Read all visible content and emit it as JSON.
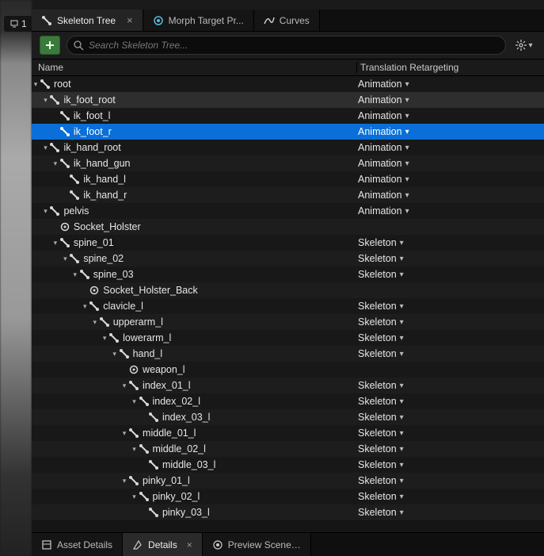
{
  "viewport_badge": "1",
  "tabs": [
    {
      "label": "Skeleton Tree",
      "active": true,
      "closable": true,
      "icon": "bone"
    },
    {
      "label": "Morph Target Pr...",
      "active": false,
      "closable": false,
      "icon": "morph"
    },
    {
      "label": "Curves",
      "active": false,
      "closable": false,
      "icon": "curve"
    }
  ],
  "search": {
    "placeholder": "Search Skeleton Tree..."
  },
  "columns": {
    "name": "Name",
    "retarget": "Translation Retargeting"
  },
  "retarget_values": {
    "animation": "Animation",
    "skeleton": "Skeleton"
  },
  "tree": [
    {
      "name": "root",
      "depth": 0,
      "type": "bone",
      "expand": "open",
      "ret": "animation",
      "state": ""
    },
    {
      "name": "ik_foot_root",
      "depth": 1,
      "type": "bone",
      "expand": "open",
      "ret": "animation",
      "state": "hovered"
    },
    {
      "name": "ik_foot_l",
      "depth": 2,
      "type": "bone",
      "expand": "",
      "ret": "animation",
      "state": ""
    },
    {
      "name": "ik_foot_r",
      "depth": 2,
      "type": "bone",
      "expand": "",
      "ret": "animation",
      "state": "selected"
    },
    {
      "name": "ik_hand_root",
      "depth": 1,
      "type": "bone",
      "expand": "open",
      "ret": "animation",
      "state": ""
    },
    {
      "name": "ik_hand_gun",
      "depth": 2,
      "type": "bone",
      "expand": "open",
      "ret": "animation",
      "state": ""
    },
    {
      "name": "ik_hand_l",
      "depth": 3,
      "type": "bone",
      "expand": "",
      "ret": "animation",
      "state": ""
    },
    {
      "name": "ik_hand_r",
      "depth": 3,
      "type": "bone",
      "expand": "",
      "ret": "animation",
      "state": ""
    },
    {
      "name": "pelvis",
      "depth": 1,
      "type": "bone",
      "expand": "open",
      "ret": "animation",
      "state": ""
    },
    {
      "name": "Socket_Holster",
      "depth": 2,
      "type": "socket",
      "expand": "",
      "ret": "",
      "state": ""
    },
    {
      "name": "spine_01",
      "depth": 2,
      "type": "bone",
      "expand": "open",
      "ret": "skeleton",
      "state": ""
    },
    {
      "name": "spine_02",
      "depth": 3,
      "type": "bone",
      "expand": "open",
      "ret": "skeleton",
      "state": ""
    },
    {
      "name": "spine_03",
      "depth": 4,
      "type": "bone",
      "expand": "open",
      "ret": "skeleton",
      "state": ""
    },
    {
      "name": "Socket_Holster_Back",
      "depth": 5,
      "type": "socket",
      "expand": "",
      "ret": "",
      "state": ""
    },
    {
      "name": "clavicle_l",
      "depth": 5,
      "type": "bone",
      "expand": "open",
      "ret": "skeleton",
      "state": ""
    },
    {
      "name": "upperarm_l",
      "depth": 6,
      "type": "bone",
      "expand": "open",
      "ret": "skeleton",
      "state": ""
    },
    {
      "name": "lowerarm_l",
      "depth": 7,
      "type": "bone",
      "expand": "open",
      "ret": "skeleton",
      "state": ""
    },
    {
      "name": "hand_l",
      "depth": 8,
      "type": "bone",
      "expand": "open",
      "ret": "skeleton",
      "state": ""
    },
    {
      "name": "weapon_l",
      "depth": 9,
      "type": "socket",
      "expand": "",
      "ret": "",
      "state": ""
    },
    {
      "name": "index_01_l",
      "depth": 9,
      "type": "bone",
      "expand": "open",
      "ret": "skeleton",
      "state": ""
    },
    {
      "name": "index_02_l",
      "depth": 10,
      "type": "bone",
      "expand": "open",
      "ret": "skeleton",
      "state": ""
    },
    {
      "name": "index_03_l",
      "depth": 11,
      "type": "bone",
      "expand": "",
      "ret": "skeleton",
      "state": ""
    },
    {
      "name": "middle_01_l",
      "depth": 9,
      "type": "bone",
      "expand": "open",
      "ret": "skeleton",
      "state": ""
    },
    {
      "name": "middle_02_l",
      "depth": 10,
      "type": "bone",
      "expand": "open",
      "ret": "skeleton",
      "state": ""
    },
    {
      "name": "middle_03_l",
      "depth": 11,
      "type": "bone",
      "expand": "",
      "ret": "skeleton",
      "state": ""
    },
    {
      "name": "pinky_01_l",
      "depth": 9,
      "type": "bone",
      "expand": "open",
      "ret": "skeleton",
      "state": ""
    },
    {
      "name": "pinky_02_l",
      "depth": 10,
      "type": "bone",
      "expand": "open",
      "ret": "skeleton",
      "state": ""
    },
    {
      "name": "pinky_03_l",
      "depth": 11,
      "type": "bone",
      "expand": "",
      "ret": "skeleton",
      "state": ""
    }
  ],
  "bottom_tabs": [
    {
      "label": "Asset Details",
      "active": false,
      "icon": "asset"
    },
    {
      "label": "Details",
      "active": true,
      "closable": true,
      "icon": "details"
    },
    {
      "label": "Preview Scene…",
      "active": false,
      "icon": "preview"
    }
  ]
}
